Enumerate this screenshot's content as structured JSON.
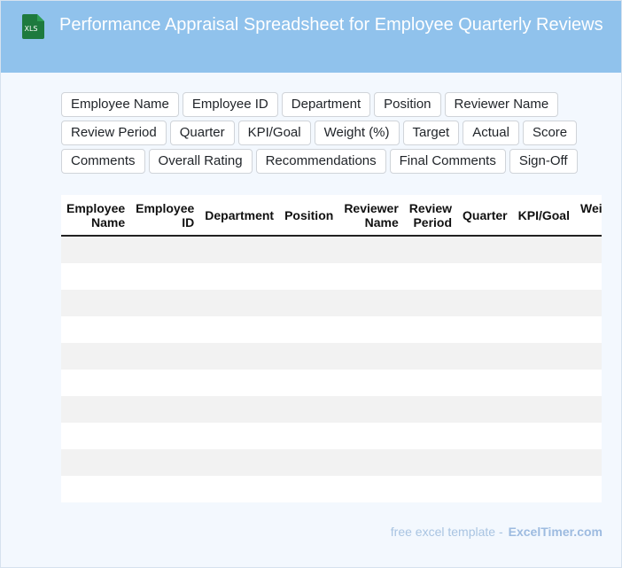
{
  "header": {
    "title": "Performance Appraisal Spreadsheet for Employee Quarterly Reviews",
    "icon": "xls-file-icon",
    "icon_label": "XLS",
    "background": "#90c2ec"
  },
  "fields": [
    "Employee Name",
    "Employee ID",
    "Department",
    "Position",
    "Reviewer Name",
    "Review Period",
    "Quarter",
    "KPI/Goal",
    "Weight (%)",
    "Target",
    "Actual",
    "Score",
    "Comments",
    "Overall Rating",
    "Recommendations",
    "Final Comments",
    "Sign-Off"
  ],
  "table": {
    "columns": [
      {
        "label": "Employee Name"
      },
      {
        "label": "Employee ID"
      },
      {
        "label": "Department"
      },
      {
        "label": "Position"
      },
      {
        "label": "Reviewer Name"
      },
      {
        "label": "Review Period"
      },
      {
        "label": "Quarter"
      },
      {
        "label": "KPI/Goal"
      },
      {
        "label": "Weight (%)"
      }
    ],
    "row_count": 10
  },
  "footer": {
    "text": "free excel template -",
    "brand": "ExcelTimer.com"
  }
}
